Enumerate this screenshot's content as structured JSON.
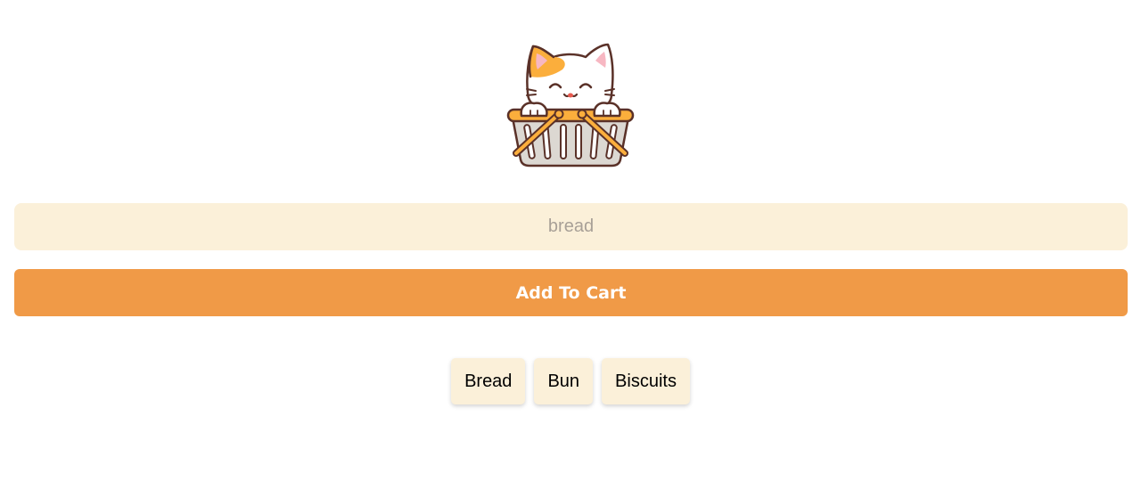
{
  "logo": {
    "icon": "cat-in-basket-icon"
  },
  "form": {
    "input_placeholder": "bread",
    "input_value": "",
    "add_button_label": "Add To Cart"
  },
  "cart": {
    "items": [
      {
        "label": "Bread"
      },
      {
        "label": "Bun"
      },
      {
        "label": "Biscuits"
      }
    ]
  },
  "colors": {
    "accent": "#f09a47",
    "input_bg": "#fbf0d9",
    "item_bg": "#fbf0d9",
    "outline": "#5a3128",
    "cat_patch": "#fbae3c"
  }
}
